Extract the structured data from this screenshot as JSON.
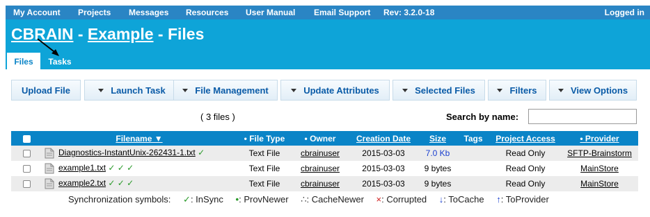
{
  "topnav": {
    "items": [
      "My Account",
      "Projects",
      "Messages",
      "Resources",
      "User Manual",
      "Email Support"
    ],
    "rev": "Rev: 3.2.0-18",
    "logged": "Logged in"
  },
  "header": {
    "brand": "CBRAIN",
    "sep1": " - ",
    "project": "Example",
    "sep2": " - Files"
  },
  "tabs": [
    "Files",
    "Tasks"
  ],
  "toolbar": {
    "upload": "Upload File",
    "launch": "Launch Task",
    "file_mgmt": "File Management",
    "update_attr": "Update Attributes",
    "selected": "Selected Files",
    "filters": "Filters",
    "view_opts": "View Options"
  },
  "count": "( 3 files )",
  "search": {
    "label": "Search by name:",
    "value": ""
  },
  "table": {
    "headers": {
      "filename": "Filename ▼",
      "file_type": "• File Type",
      "owner": "• Owner",
      "creation": "Creation Date",
      "size": "Size",
      "tags": "Tags",
      "access": "Project Access",
      "provider": "• Provider"
    },
    "rows": [
      {
        "name": "Diagnostics-InstantUnix-262431-1.txt",
        "sync": "✓",
        "type": "Text File",
        "owner": "cbrainuser",
        "date": "2015-03-03",
        "size": "7.0 Kb",
        "tags": "",
        "access": "Read Only",
        "provider": "SFTP-Brainstorm"
      },
      {
        "name": "example1.txt",
        "sync": "✓ ✓ ✓",
        "type": "Text File",
        "owner": "cbrainuser",
        "date": "2015-03-03",
        "size": "9 bytes",
        "tags": "",
        "access": "Read Only",
        "provider": "MainStore"
      },
      {
        "name": "example2.txt",
        "sync": "✓ ✓ ✓",
        "type": "Text File",
        "owner": "cbrainuser",
        "date": "2015-03-03",
        "size": "9 bytes",
        "tags": "",
        "access": "Read Only",
        "provider": "MainStore"
      }
    ]
  },
  "legend": {
    "label": "Synchronization symbols:",
    "insync_sym": "✓",
    "insync": ": InSync",
    "provnewer_sym": "•",
    "provnewer": ": ProvNewer",
    "cachenewer_sym": "∴",
    "cachenewer": ": CacheNewer",
    "corrupted_sym": "×",
    "corrupted": ": Corrupted",
    "tocache_sym": "↓",
    "tocache": ": ToCache",
    "toprovider_sym": "↑",
    "toprovider": ": ToProvider"
  }
}
